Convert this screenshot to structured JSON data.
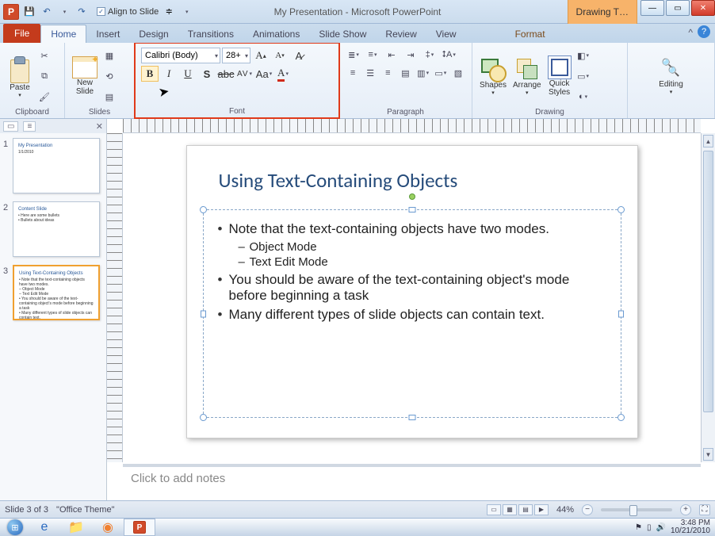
{
  "titlebar": {
    "app_title": "My Presentation  -  Microsoft PowerPoint",
    "align_to_slide": "Align to Slide",
    "drawing_tools": "Drawing T…"
  },
  "tabs": {
    "file": "File",
    "home": "Home",
    "insert": "Insert",
    "design": "Design",
    "transitions": "Transitions",
    "animations": "Animations",
    "slideshow": "Slide Show",
    "review": "Review",
    "view": "View",
    "format": "Format"
  },
  "ribbon": {
    "clipboard": {
      "label": "Clipboard",
      "paste": "Paste"
    },
    "slides": {
      "label": "Slides",
      "new_slide": "New\nSlide"
    },
    "font": {
      "label": "Font",
      "font_name": "Calibri (Body)",
      "font_size": "28+"
    },
    "paragraph": {
      "label": "Paragraph"
    },
    "drawing": {
      "label": "Drawing",
      "shapes": "Shapes",
      "arrange": "Arrange",
      "quick_styles": "Quick\nStyles"
    },
    "editing": {
      "label": "Editing"
    }
  },
  "pane_tabs": {
    "slides": "",
    "outline": ""
  },
  "thumbnails": [
    {
      "num": "1",
      "title": "My Presentation",
      "lines": [
        "1/1/2010"
      ]
    },
    {
      "num": "2",
      "title": "Content Slide",
      "lines": [
        "• Here are some bullets",
        "• Bullets about ideas"
      ]
    },
    {
      "num": "3",
      "title": "Using Text-Containing Objects",
      "lines": [
        "• Note that the text-containing objects have two modes.",
        "  – Object Mode",
        "  – Text Edit Mode",
        "• You should be aware of the text-containing object's mode before beginning a task",
        "• Many different types of slide objects can contain text."
      ]
    }
  ],
  "slide": {
    "title": "Using Text-Containing Objects",
    "bullets": [
      {
        "level": 1,
        "text": "Note that the text-containing objects have two modes."
      },
      {
        "level": 2,
        "text": "Object Mode"
      },
      {
        "level": 2,
        "text": "Text Edit Mode"
      },
      {
        "level": 1,
        "text": "You should be aware of the text-containing object's mode before beginning a task"
      },
      {
        "level": 1,
        "text": "Many different types of slide objects can contain text."
      }
    ]
  },
  "notes": {
    "placeholder": "Click to add notes"
  },
  "status": {
    "slide_of": "Slide 3 of 3",
    "theme": "\"Office Theme\"",
    "zoom": "44%"
  },
  "tray": {
    "time": "3:48 PM",
    "date": "10/21/2010"
  }
}
